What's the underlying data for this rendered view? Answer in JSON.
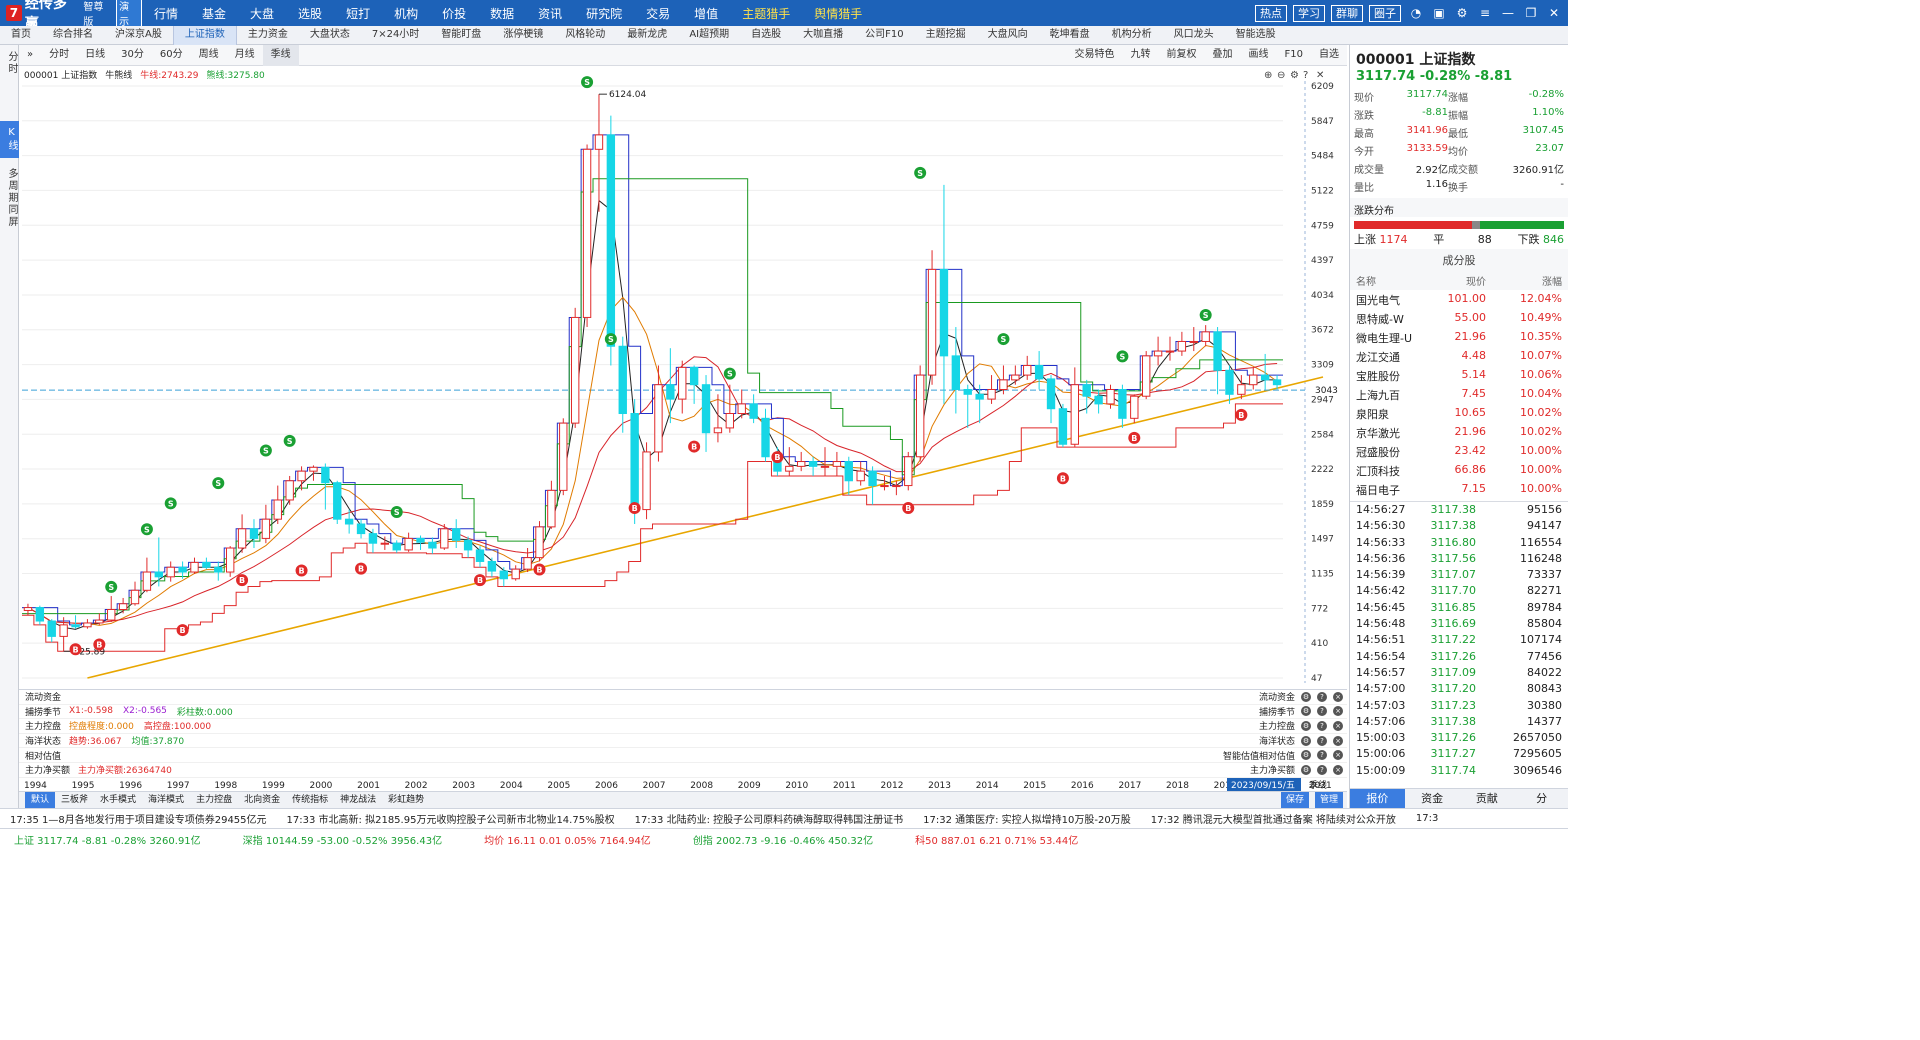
{
  "app": {
    "name": "经传多赢",
    "edition": "智尊版",
    "badge": "演示"
  },
  "menu": [
    "行情",
    "基金",
    "大盘",
    "选股",
    "短打",
    "机构",
    "价投",
    "数据",
    "资讯",
    "研究院",
    "交易",
    "增值",
    "主题猎手",
    "舆情猎手"
  ],
  "menu_highlight": [
    "主题猎手",
    "舆情猎手"
  ],
  "top_buttons": [
    "热点",
    "学习",
    "群聊",
    "圈子"
  ],
  "tabs": [
    "首页",
    "综合排名",
    "沪深京A股",
    "上证指数",
    "主力资金",
    "大盘状态",
    "7×24小时",
    "智能盯盘",
    "涨停梗镜",
    "风格轮动",
    "最新龙虎",
    "AI超预期",
    "自选股",
    "大咖直播",
    "公司F10",
    "主题挖掘",
    "大盘风向",
    "乾坤看盘",
    "机构分析",
    "风口龙头",
    "智能选股"
  ],
  "active_tab": "上证指数",
  "sidebar": [
    "分时",
    "K线",
    "多周期同屏"
  ],
  "sidebar_active": "K线",
  "chart_toolbar": {
    "left": [
      "分时",
      "日线",
      "30分",
      "60分",
      "周线",
      "月线",
      "季线"
    ],
    "selected": "季线",
    "right": [
      "交易特色",
      "九转",
      "前复权",
      "叠加",
      "画线",
      "F10",
      "自选"
    ]
  },
  "chart_header": {
    "code_name": "000001 上证指数",
    "indicator": "牛熊线",
    "niu_label": "牛线:2743.29",
    "xiong_label": "熊线:3275.80"
  },
  "chart_data": {
    "type": "candlestick",
    "years": [
      "1994",
      "1995",
      "1996",
      "1997",
      "1998",
      "1999",
      "2000",
      "2001",
      "2002",
      "2003",
      "2004",
      "2005",
      "2006",
      "2007",
      "2008",
      "2009",
      "2010",
      "2011",
      "2012",
      "2013",
      "2014",
      "2015",
      "2016",
      "2017",
      "2018",
      "2019",
      "2020",
      "2021"
    ],
    "y_ticks": [
      47,
      410,
      772,
      1135,
      1497,
      1859,
      2222,
      2584,
      2947,
      3309,
      3672,
      4034,
      4397,
      4759,
      5122,
      5484,
      5847,
      6209
    ],
    "ylim": [
      47,
      6209
    ],
    "high_label": "6124.04",
    "low_label": "325.89",
    "current_line": "3043",
    "date_label": "2023/09/15/五",
    "period_label": "季线",
    "quarters": [
      [
        750,
        780,
        700,
        820
      ],
      [
        780,
        640,
        600,
        800
      ],
      [
        640,
        480,
        420,
        660
      ],
      [
        480,
        600,
        325,
        680
      ],
      [
        600,
        580,
        560,
        700
      ],
      [
        580,
        620,
        560,
        660
      ],
      [
        620,
        650,
        600,
        720
      ],
      [
        650,
        760,
        630,
        900
      ],
      [
        760,
        820,
        720,
        880
      ],
      [
        820,
        960,
        800,
        1050
      ],
      [
        960,
        1150,
        940,
        1300
      ],
      [
        1150,
        1100,
        1000,
        1510
      ],
      [
        1100,
        1200,
        1050,
        1260
      ],
      [
        1200,
        1150,
        1080,
        1260
      ],
      [
        1150,
        1250,
        1130,
        1300
      ],
      [
        1250,
        1200,
        1180,
        1300
      ],
      [
        1200,
        1150,
        1060,
        1260
      ],
      [
        1150,
        1400,
        1100,
        1420
      ],
      [
        1400,
        1600,
        1350,
        1750
      ],
      [
        1600,
        1500,
        1400,
        1700
      ],
      [
        1500,
        1700,
        1450,
        1850
      ],
      [
        1700,
        1900,
        1650,
        2050
      ],
      [
        1900,
        2100,
        1850,
        2150
      ],
      [
        2100,
        2200,
        2000,
        2250
      ],
      [
        2200,
        2240,
        2100,
        2260
      ],
      [
        2240,
        2080,
        1800,
        2280
      ],
      [
        2080,
        1700,
        1650,
        2100
      ],
      [
        1700,
        1650,
        1550,
        1800
      ],
      [
        1650,
        1550,
        1500,
        1700
      ],
      [
        1550,
        1450,
        1350,
        1600
      ],
      [
        1450,
        1450,
        1380,
        1520
      ],
      [
        1450,
        1380,
        1350,
        1480
      ],
      [
        1380,
        1500,
        1360,
        1560
      ],
      [
        1500,
        1460,
        1380,
        1530
      ],
      [
        1460,
        1400,
        1340,
        1510
      ],
      [
        1400,
        1600,
        1380,
        1650
      ],
      [
        1600,
        1480,
        1400,
        1700
      ],
      [
        1480,
        1380,
        1300,
        1520
      ],
      [
        1380,
        1260,
        1200,
        1420
      ],
      [
        1260,
        1160,
        1100,
        1300
      ],
      [
        1160,
        1080,
        1000,
        1200
      ],
      [
        1080,
        1180,
        1060,
        1220
      ],
      [
        1180,
        1300,
        1150,
        1400
      ],
      [
        1300,
        1620,
        1260,
        1680
      ],
      [
        1620,
        2000,
        1600,
        2100
      ],
      [
        2000,
        2700,
        1950,
        2750
      ],
      [
        2700,
        3800,
        2650,
        3900
      ],
      [
        3800,
        5550,
        3700,
        5600
      ],
      [
        5550,
        5700,
        4900,
        6124
      ],
      [
        5700,
        3500,
        3300,
        5900
      ],
      [
        3500,
        2800,
        2600,
        3600
      ],
      [
        2800,
        1800,
        1650,
        2950
      ],
      [
        1800,
        2400,
        1700,
        2500
      ],
      [
        2400,
        3100,
        2300,
        3300
      ],
      [
        3100,
        2950,
        2700,
        3480
      ],
      [
        2950,
        3280,
        2800,
        3350
      ],
      [
        3280,
        3100,
        2900,
        3300
      ],
      [
        3100,
        2600,
        2400,
        3200
      ],
      [
        2600,
        2650,
        2500,
        3000
      ],
      [
        2650,
        2800,
        2600,
        3100
      ],
      [
        2800,
        2900,
        2750,
        3050
      ],
      [
        2900,
        2750,
        2700,
        3000
      ],
      [
        2750,
        2350,
        2300,
        2850
      ],
      [
        2350,
        2200,
        2150,
        2450
      ],
      [
        2200,
        2250,
        2150,
        2450
      ],
      [
        2250,
        2300,
        2200,
        2400
      ],
      [
        2300,
        2250,
        2150,
        2350
      ],
      [
        2250,
        2250,
        2150,
        2450
      ],
      [
        2250,
        2300,
        2150,
        2400
      ],
      [
        2300,
        2100,
        1950,
        2350
      ],
      [
        2100,
        2200,
        2050,
        2300
      ],
      [
        2200,
        2050,
        1850,
        2250
      ],
      [
        2050,
        2050,
        2000,
        2150
      ],
      [
        2050,
        2050,
        1950,
        2100
      ],
      [
        2050,
        2350,
        2000,
        2400
      ],
      [
        2350,
        3200,
        2300,
        3300
      ],
      [
        3200,
        4300,
        3100,
        4500
      ],
      [
        4300,
        3400,
        2900,
        5180
      ],
      [
        3400,
        3050,
        2800,
        3700
      ],
      [
        3050,
        3000,
        2650,
        3100
      ],
      [
        3000,
        2950,
        2700,
        3100
      ],
      [
        2950,
        3050,
        2900,
        3200
      ],
      [
        3050,
        3150,
        3000,
        3300
      ],
      [
        3150,
        3200,
        3100,
        3300
      ],
      [
        3200,
        3300,
        3150,
        3400
      ],
      [
        3300,
        3160,
        3050,
        3450
      ],
      [
        3160,
        2850,
        2700,
        3200
      ],
      [
        2850,
        2480,
        2450,
        2900
      ],
      [
        2480,
        3100,
        2450,
        3280
      ],
      [
        3100,
        2980,
        2800,
        3150
      ],
      [
        2980,
        2900,
        2800,
        3050
      ],
      [
        2900,
        3050,
        2850,
        3100
      ],
      [
        3050,
        2750,
        2650,
        3100
      ],
      [
        2750,
        2980,
        2700,
        3000
      ],
      [
        2980,
        3400,
        2950,
        3450
      ],
      [
        3400,
        3450,
        3300,
        3600
      ],
      [
        3450,
        3450,
        3350,
        3600
      ],
      [
        3450,
        3550,
        3400,
        3650
      ],
      [
        3550,
        3550,
        3450,
        3700
      ],
      [
        3550,
        3650,
        3500,
        3720
      ],
      [
        3650,
        3250,
        3000,
        3700
      ],
      [
        3250,
        3000,
        2900,
        3300
      ],
      [
        3000,
        3100,
        2950,
        3200
      ],
      [
        3100,
        3200,
        3050,
        3280
      ],
      [
        3200,
        3150,
        3050,
        3420
      ],
      [
        3150,
        3100,
        3050,
        3200
      ]
    ],
    "signals_S": [
      [
        7,
        870
      ],
      [
        10,
        1470
      ],
      [
        12,
        1740
      ],
      [
        16,
        1950
      ],
      [
        20,
        2290
      ],
      [
        22,
        2390
      ],
      [
        31,
        1650
      ],
      [
        47,
        6124
      ],
      [
        49,
        3450
      ],
      [
        59,
        3090
      ],
      [
        75,
        5180
      ],
      [
        82,
        3450
      ],
      [
        92,
        3270
      ],
      [
        99,
        3700
      ]
    ],
    "signals_B": [
      [
        4,
        450
      ],
      [
        6,
        500
      ],
      [
        13,
        650
      ],
      [
        18,
        1170
      ],
      [
        23,
        1270
      ],
      [
        28,
        1290
      ],
      [
        38,
        1170
      ],
      [
        43,
        1280
      ],
      [
        51,
        1920
      ],
      [
        56,
        2560
      ],
      [
        63,
        2450
      ],
      [
        74,
        1920
      ],
      [
        87,
        2230
      ],
      [
        93,
        2650
      ],
      [
        102,
        2890
      ]
    ]
  },
  "indicators": [
    {
      "name": "流动资金",
      "parts": [],
      "right": "流动资金"
    },
    {
      "name": "捕捞季节",
      "parts": [
        {
          "t": "X1:-0.598",
          "c": "#e02a2a"
        },
        {
          "t": "X2:-0.565",
          "c": "#9b1fd1"
        },
        {
          "t": "彩柱数:0.000",
          "c": "#1aa033"
        }
      ],
      "right": "捕捞季节"
    },
    {
      "name": "主力控盘",
      "parts": [
        {
          "t": "控盘程度:0.000",
          "c": "#e07b00"
        },
        {
          "t": "高控盘:100.000",
          "c": "#e02a2a"
        }
      ],
      "right": "主力控盘"
    },
    {
      "name": "海洋状态",
      "parts": [
        {
          "t": "趋势:36.067",
          "c": "#e02a2a"
        },
        {
          "t": "均值:37.870",
          "c": "#1aa033"
        }
      ],
      "right": "海洋状态"
    },
    {
      "name": "相对估值",
      "parts": [],
      "right": "智能估值相对估值"
    },
    {
      "name": "主力净买额",
      "parts": [
        {
          "t": "主力净买额:26364740",
          "c": "#e02a2a"
        }
      ],
      "right": "主力净买额"
    }
  ],
  "bottom_tabs": [
    "默认",
    "三板斧",
    "水手模式",
    "海洋模式",
    "主力控盘",
    "北向资金",
    "传统指标",
    "神龙战法",
    "彩虹趋势"
  ],
  "bottom_right": [
    "保存",
    "管理"
  ],
  "quote": {
    "code": "000001 上证指数",
    "price_line": "3117.74 -0.28% -8.81",
    "rows": [
      [
        "现价",
        "3117.74",
        "涨幅",
        "-0.28%"
      ],
      [
        "涨跌",
        "-8.81",
        "振幅",
        "1.10%"
      ],
      [
        "最高",
        "3141.96",
        "最低",
        "3107.45"
      ],
      [
        "今开",
        "3133.59",
        "均价",
        "23.07"
      ],
      [
        "成交量",
        "2.92亿",
        "成交额",
        "3260.91亿"
      ],
      [
        "量比",
        "1.16",
        "换手",
        "-"
      ]
    ],
    "dist_title": "涨跌分布",
    "up_label": "上涨",
    "up": "1174",
    "flat_label": "平",
    "flat": "88",
    "down_label": "下跌",
    "down": "846",
    "components_title": "成分股",
    "col_headers": [
      "名称",
      "现价",
      "涨幅"
    ],
    "stocks": [
      [
        "国光电气",
        "101.00",
        "12.04%"
      ],
      [
        "思特威-W",
        "55.00",
        "10.49%"
      ],
      [
        "微电生理-U",
        "21.96",
        "10.35%"
      ],
      [
        "龙江交通",
        "4.48",
        "10.07%"
      ],
      [
        "宝胜股份",
        "5.14",
        "10.06%"
      ],
      [
        "上海九百",
        "7.45",
        "10.04%"
      ],
      [
        "泉阳泉",
        "10.65",
        "10.02%"
      ],
      [
        "京华激光",
        "21.96",
        "10.02%"
      ],
      [
        "冠盛股份",
        "23.42",
        "10.00%"
      ],
      [
        "汇顶科技",
        "66.86",
        "10.00%"
      ],
      [
        "福日电子",
        "7.15",
        "10.00%"
      ]
    ],
    "ticks": [
      [
        "14:56:27",
        "3117.38",
        "95156"
      ],
      [
        "14:56:30",
        "3117.38",
        "94147"
      ],
      [
        "14:56:33",
        "3116.80",
        "116554"
      ],
      [
        "14:56:36",
        "3117.56",
        "116248"
      ],
      [
        "14:56:39",
        "3117.07",
        "73337"
      ],
      [
        "14:56:42",
        "3117.70",
        "82271"
      ],
      [
        "14:56:45",
        "3116.85",
        "89784"
      ],
      [
        "14:56:48",
        "3116.69",
        "85804"
      ],
      [
        "14:56:51",
        "3117.22",
        "107174"
      ],
      [
        "14:56:54",
        "3117.26",
        "77456"
      ],
      [
        "14:56:57",
        "3117.09",
        "84022"
      ],
      [
        "14:57:00",
        "3117.20",
        "80843"
      ],
      [
        "14:57:03",
        "3117.23",
        "30380"
      ],
      [
        "14:57:06",
        "3117.38",
        "14377"
      ],
      [
        "15:00:03",
        "3117.26",
        "2657050"
      ],
      [
        "15:00:06",
        "3117.27",
        "7295605"
      ],
      [
        "15:00:09",
        "3117.74",
        "3096546"
      ]
    ],
    "tabs": [
      "报价",
      "资金",
      "贡献",
      "分"
    ]
  },
  "news": [
    "17:35 1—8月各地发行用于项目建设专项债券29455亿元",
    "17:33 市北高新: 拟2185.95万元收购控股子公司新市北物业14.75%股权",
    "17:33 北陆药业: 控股子公司原料药碘海醇取得韩国注册证书",
    "17:32 通策医疗: 实控人拟增持10万股-20万股",
    "17:32 腾讯混元大模型首批通过备案 将陆续对公众开放",
    "17:3"
  ],
  "status": [
    {
      "t": "上证 3117.74 -8.81 -0.28% 3260.91亿",
      "c": "#1aa033"
    },
    {
      "t": "深指 10144.59 -53.00 -0.52% 3956.43亿",
      "c": "#1aa033"
    },
    {
      "t": "均价 16.11 0.01 0.05% 7164.94亿",
      "c": "#e02a2a"
    },
    {
      "t": "创指 2002.73 -9.16 -0.46% 450.32亿",
      "c": "#1aa033"
    },
    {
      "t": "科50 887.01 6.21 0.71% 53.44亿",
      "c": "#e02a2a"
    }
  ],
  "colors": {
    "up": "#e02a2a",
    "down": "#16d6e6",
    "accent": "#1d62b8",
    "trend": "#e8a600"
  }
}
